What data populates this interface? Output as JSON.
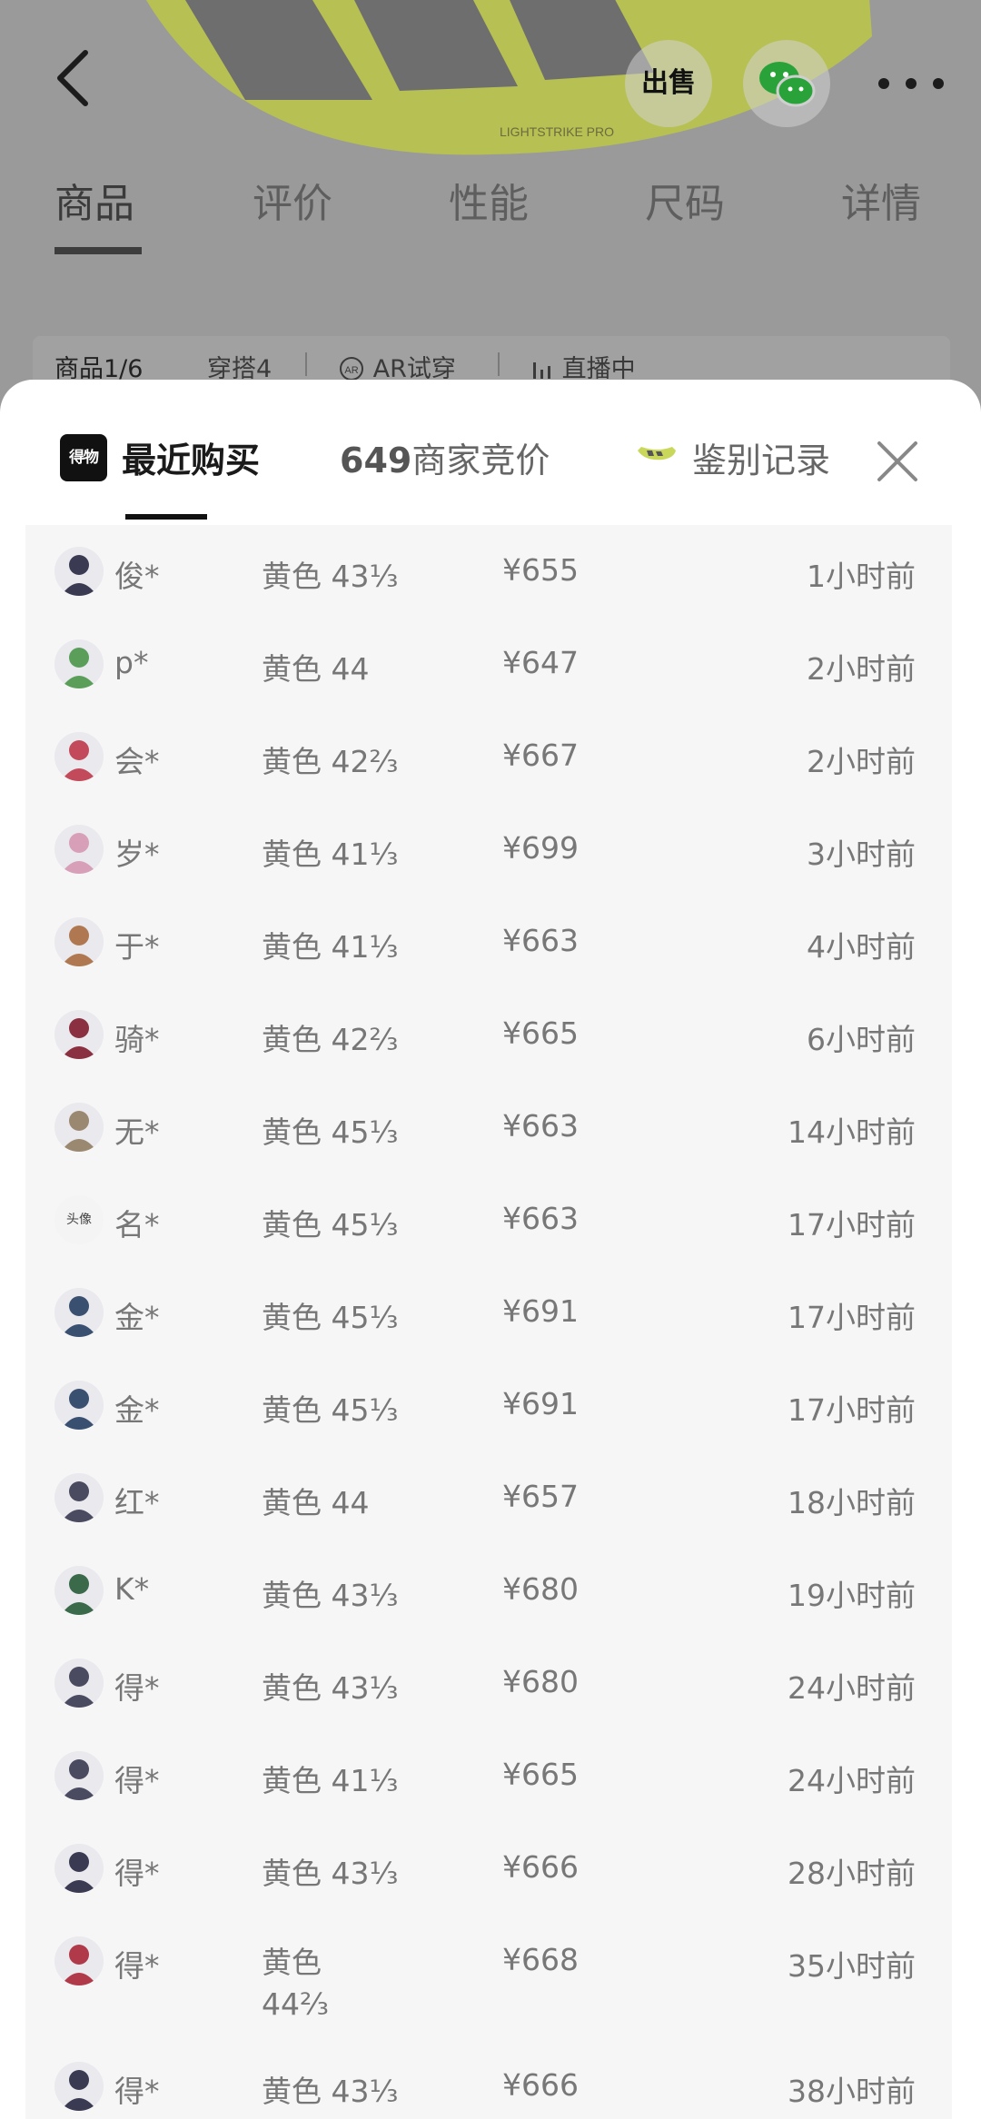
{
  "header": {
    "sell_label": "出售",
    "nav_tabs": [
      "商品",
      "评价",
      "性能",
      "尺码",
      "详情"
    ],
    "active_nav": "商品"
  },
  "chips": {
    "product": "商品1/6",
    "outfit": "穿搭4",
    "ar": "AR试穿",
    "live": "直播中"
  },
  "sheet": {
    "logo_text": "得物",
    "tabs": {
      "recent": "最近购买",
      "bid_count": "649",
      "bid_label": "商家竞价",
      "auth": "鉴别记录"
    },
    "records": [
      {
        "user": "俊*",
        "spec": "黄色 43⅓",
        "price": "¥655",
        "time": "1小时前",
        "avatar_color": "#3a3a52"
      },
      {
        "user": "p*",
        "spec": "黄色 44",
        "price": "¥647",
        "time": "2小时前",
        "avatar_color": "#5a9e5a"
      },
      {
        "user": "会*",
        "spec": "黄色 42⅔",
        "price": "¥667",
        "time": "2小时前",
        "avatar_color": "#c24a5a"
      },
      {
        "user": "岁*",
        "spec": "黄色 41⅓",
        "price": "¥699",
        "time": "3小时前",
        "avatar_color": "#d8a0b8"
      },
      {
        "user": "于*",
        "spec": "黄色 41⅓",
        "price": "¥663",
        "time": "4小时前",
        "avatar_color": "#b07850"
      },
      {
        "user": "骑*",
        "spec": "黄色 42⅔",
        "price": "¥665",
        "time": "6小时前",
        "avatar_color": "#8a3040"
      },
      {
        "user": "无*",
        "spec": "黄色 45⅓",
        "price": "¥663",
        "time": "14小时前",
        "avatar_color": "#9a8870"
      },
      {
        "user": "名*",
        "spec": "黄色 45⅓",
        "price": "¥663",
        "time": "17小时前",
        "avatar_color": "#f4f4f4",
        "avatar_text": "头像"
      },
      {
        "user": "金*",
        "spec": "黄色 45⅓",
        "price": "¥691",
        "time": "17小时前",
        "avatar_color": "#3a5070"
      },
      {
        "user": "金*",
        "spec": "黄色 45⅓",
        "price": "¥691",
        "time": "17小时前",
        "avatar_color": "#3a5070"
      },
      {
        "user": "红*",
        "spec": "黄色 44",
        "price": "¥657",
        "time": "18小时前",
        "avatar_color": "#4a4a60"
      },
      {
        "user": "K*",
        "spec": "黄色 43⅓",
        "price": "¥680",
        "time": "19小时前",
        "avatar_color": "#3a6a4a"
      },
      {
        "user": "得*",
        "spec": "黄色 43⅓",
        "price": "¥680",
        "time": "24小时前",
        "avatar_color": "#4a4a60"
      },
      {
        "user": "得*",
        "spec": "黄色 41⅓",
        "price": "¥665",
        "time": "24小时前",
        "avatar_color": "#4a4a60"
      },
      {
        "user": "得*",
        "spec": "黄色 43⅓",
        "price": "¥666",
        "time": "28小时前",
        "avatar_color": "#3a3a52"
      },
      {
        "user": "得*",
        "spec": "黄色 44⅔",
        "price": "¥668",
        "time": "35小时前",
        "avatar_color": "#b03a4a"
      },
      {
        "user": "得*",
        "spec": "黄色 43⅓",
        "price": "¥666",
        "time": "38小时前",
        "avatar_color": "#3a3a52"
      }
    ]
  },
  "colors": {
    "overlay_bg": "#9a9a9a",
    "shoe_yellow": "#c9d85a",
    "wechat_green": "#2aa23a",
    "sheet_bg": "#ffffff",
    "list_bg": "#f6f6f6",
    "text_muted": "#777777"
  }
}
